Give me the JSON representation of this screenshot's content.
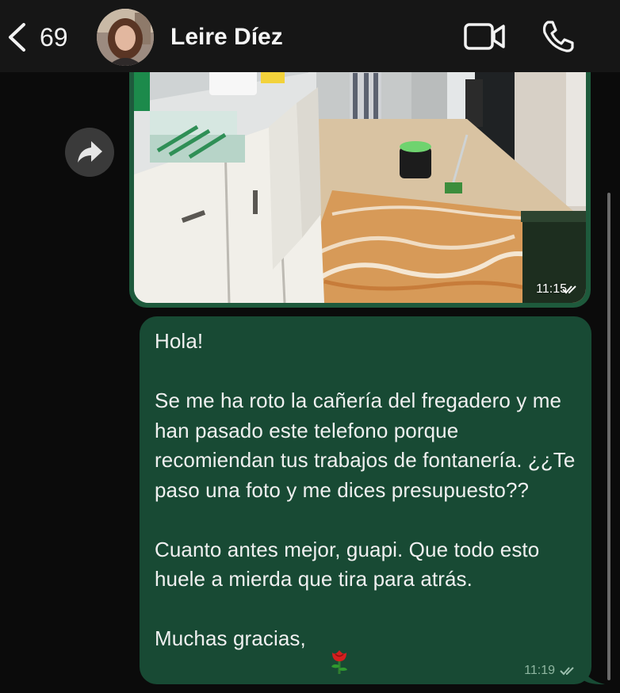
{
  "header": {
    "back_count": "69",
    "contact_name": "Leire Díez"
  },
  "image_message": {
    "time": "11:15"
  },
  "text_message": {
    "text": "Hola!\n\nSe me ha roto la cañería del fregadero y me han pasado este telefono porque recomiendan tus trabajos de fontanería. ¿¿Te paso una foto y me dices presupuesto??\n\nCuanto antes mejor, guapi. Que todo esto huele a mierda que tira para atrás.\n\nMuchas gracias,",
    "time": "11:19"
  },
  "icons": {
    "back": "chevron-left-icon",
    "video": "video-camera-icon",
    "phone": "phone-icon",
    "forward": "forward-arrow-icon",
    "read_receipt": "double-check-icon",
    "emoji": "rose-emoji"
  },
  "colors": {
    "background": "#0b0b0b",
    "header": "#161616",
    "outgoing_bubble": "#184a34",
    "image_border": "#1e5a3c"
  }
}
